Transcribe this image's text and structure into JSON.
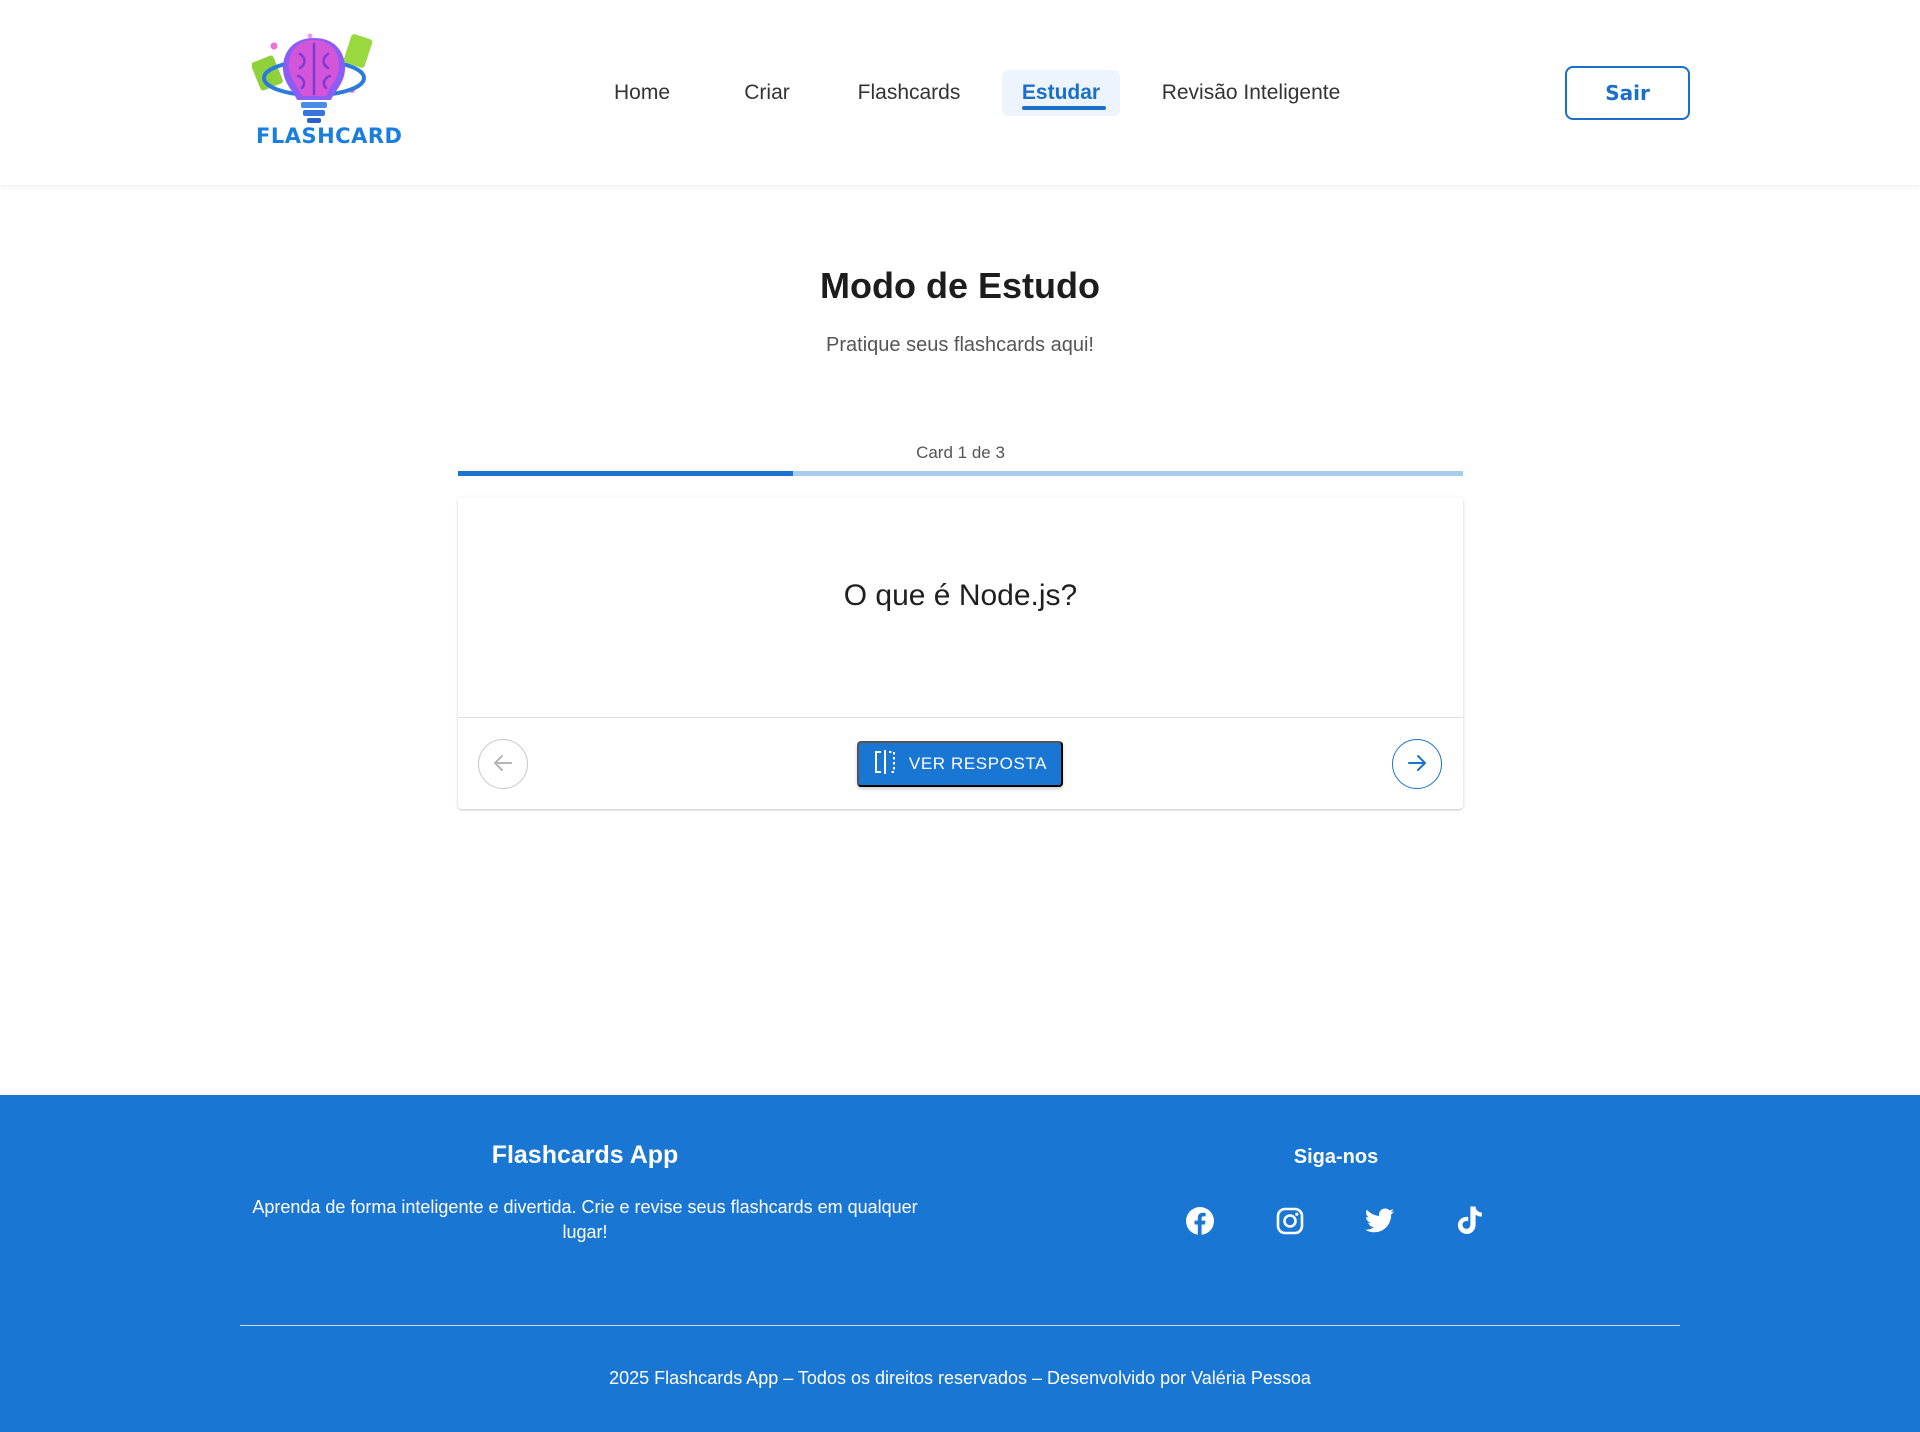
{
  "brand": {
    "logo_text": "FLASHCARD"
  },
  "nav": {
    "items": [
      {
        "label": "Home"
      },
      {
        "label": "Criar"
      },
      {
        "label": "Flashcards"
      },
      {
        "label": "Estudar",
        "active": true
      },
      {
        "label": "Revisão Inteligente"
      }
    ],
    "logout_label": "Sair"
  },
  "main": {
    "title": "Modo de Estudo",
    "subtitle": "Pratique seus flashcards aqui!",
    "progress": {
      "label": "Card 1 de 3",
      "current": 1,
      "total": 3
    },
    "card": {
      "question": "O que é Node.js?",
      "flip_label": "VER RESPOSTA",
      "prev_icon": "arrow-left-icon",
      "next_icon": "arrow-right-icon"
    }
  },
  "footer": {
    "title": "Flashcards App",
    "description": "Aprenda de forma inteligente e divertida. Crie e revise seus flashcards em qualquer lugar!",
    "follow_title": "Siga-nos",
    "social": [
      "facebook-icon",
      "instagram-icon",
      "twitter-icon",
      "tiktok-icon"
    ],
    "copyright": "2025 Flashcards App – Todos os direitos reservados – Desenvolvido por Valéria Pessoa"
  },
  "colors": {
    "primary": "#1976d2",
    "nav_active_bg": "#eef4fb",
    "progress_track": "#a9cbec",
    "progress_fill": "#1a73cc"
  }
}
